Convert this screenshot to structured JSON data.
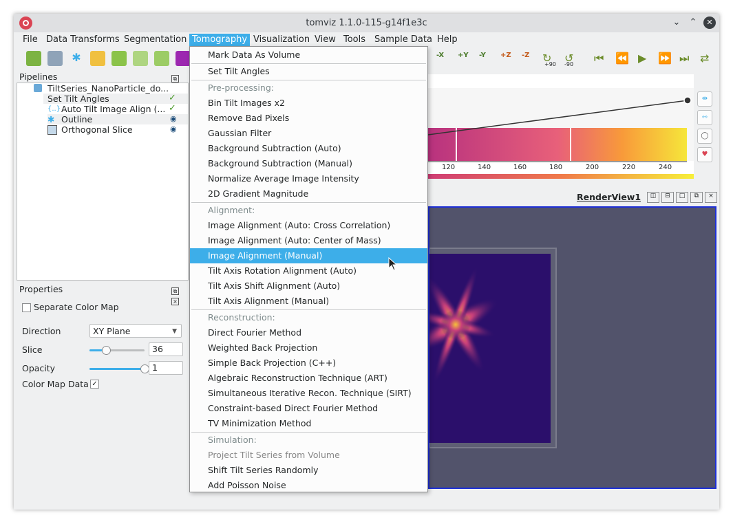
{
  "window": {
    "title": "tomviz 1.1.0-115-g14f1e3c",
    "controls": {
      "minimize": "⌄",
      "maximize": "⌃",
      "close": "✕"
    }
  },
  "menubar": {
    "items": [
      "File",
      "Data Transforms",
      "Segmentation",
      "Tomography",
      "Visualization",
      "View",
      "Tools",
      "Sample Data",
      "Help"
    ],
    "active": "Tomography"
  },
  "toolbar": {
    "axis_labels": [
      "-X",
      "+Y",
      "-Y",
      "+Z",
      "-Z"
    ],
    "rotate_labels": [
      "+90",
      "-90"
    ]
  },
  "pipelines": {
    "title": "Pipelines",
    "items": [
      {
        "label": "TiltSeries_NanoParticle_do...",
        "icon": "database-icon",
        "status": ""
      },
      {
        "label": "Set Tilt Angles",
        "icon": "",
        "status": "check"
      },
      {
        "label": "Auto Tilt Image Align (...",
        "icon": "braces-icon",
        "status": "check"
      },
      {
        "label": "Outline",
        "icon": "snowflake-icon",
        "status": "eye"
      },
      {
        "label": "Orthogonal Slice",
        "icon": "cube-icon",
        "status": "eye"
      }
    ]
  },
  "properties": {
    "title": "Properties",
    "separate_color_map": {
      "label": "Separate Color Map",
      "checked": false
    },
    "direction": {
      "label": "Direction",
      "value": "XY Plane"
    },
    "slice": {
      "label": "Slice",
      "value": "36",
      "level": 0.3
    },
    "opacity": {
      "label": "Opacity",
      "value": "1",
      "level": 1.0
    },
    "color_map_data": {
      "label": "Color Map Data",
      "checked": true,
      "mark": "✓"
    }
  },
  "histogram": {
    "tick_labels": [
      "120",
      "140",
      "160",
      "180",
      "200",
      "220",
      "240"
    ]
  },
  "render_view": {
    "label": "RenderView1",
    "colors": {
      "background": "#52536b",
      "border": "#1d2fd6",
      "slice": "#2b0f6b"
    }
  },
  "tomography_menu": {
    "items": [
      {
        "type": "item",
        "label": "Mark Data As Volume"
      },
      {
        "type": "sep"
      },
      {
        "type": "item",
        "label": "Set Tilt Angles"
      },
      {
        "type": "sep"
      },
      {
        "type": "section",
        "label": "Pre-processing:"
      },
      {
        "type": "item",
        "label": "Bin Tilt Images x2"
      },
      {
        "type": "item",
        "label": "Remove Bad Pixels"
      },
      {
        "type": "item",
        "label": "Gaussian Filter"
      },
      {
        "type": "item",
        "label": "Background Subtraction (Auto)"
      },
      {
        "type": "item",
        "label": "Background Subtraction (Manual)"
      },
      {
        "type": "item",
        "label": "Normalize Average Image Intensity"
      },
      {
        "type": "item",
        "label": "2D Gradient Magnitude"
      },
      {
        "type": "sep"
      },
      {
        "type": "section",
        "label": "Alignment:"
      },
      {
        "type": "item",
        "label": "Image Alignment (Auto: Cross Correlation)"
      },
      {
        "type": "item",
        "label": "Image Alignment (Auto: Center of Mass)"
      },
      {
        "type": "item",
        "label": "Image Alignment (Manual)",
        "highlighted": true
      },
      {
        "type": "item",
        "label": "Tilt Axis Rotation Alignment (Auto)"
      },
      {
        "type": "item",
        "label": "Tilt Axis Shift Alignment (Auto)"
      },
      {
        "type": "item",
        "label": "Tilt Axis Alignment (Manual)"
      },
      {
        "type": "sep"
      },
      {
        "type": "section",
        "label": "Reconstruction:"
      },
      {
        "type": "item",
        "label": "Direct Fourier Method"
      },
      {
        "type": "item",
        "label": "Weighted Back Projection"
      },
      {
        "type": "item",
        "label": "Simple Back Projection (C++)"
      },
      {
        "type": "item",
        "label": "Algebraic Reconstruction Technique (ART)"
      },
      {
        "type": "item",
        "label": "Simultaneous Iterative Recon. Technique (SIRT)"
      },
      {
        "type": "item",
        "label": "Constraint-based Direct Fourier Method"
      },
      {
        "type": "item",
        "label": "TV Minimization Method"
      },
      {
        "type": "sep"
      },
      {
        "type": "section",
        "label": "Simulation:"
      },
      {
        "type": "item",
        "label": "Project Tilt Series from Volume",
        "disabled": true
      },
      {
        "type": "item",
        "label": "Shift Tilt Series Randomly"
      },
      {
        "type": "item",
        "label": "Add Poisson Noise"
      }
    ]
  },
  "colors": {
    "accent": "#3daee9",
    "check": "#4a9a2a"
  }
}
